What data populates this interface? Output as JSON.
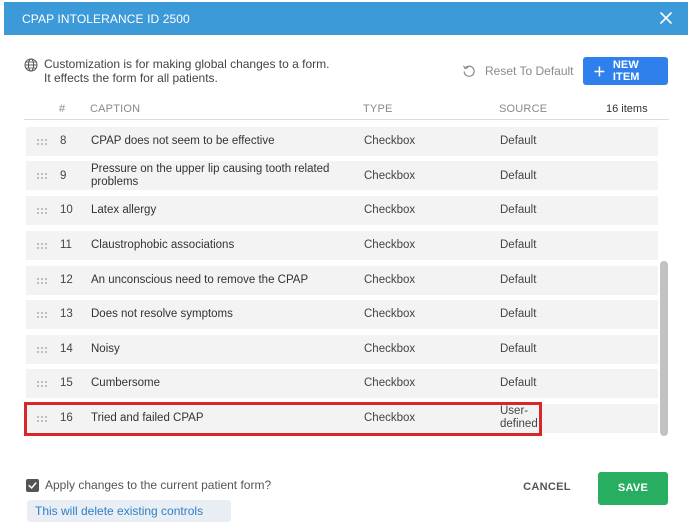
{
  "dialog": {
    "title": "CPAP INTOLERANCE  ID 2500",
    "close_icon": "close-icon"
  },
  "info": {
    "icon": "globe-icon",
    "line1": "Customization is for making global changes to a form.",
    "line2": "It effects the form for all patients."
  },
  "toolbar": {
    "reset_icon": "reset-icon",
    "reset_label": "Reset To Default",
    "new_item_icon": "plus-icon",
    "new_item_label": "NEW ITEM"
  },
  "table": {
    "columns": {
      "num": "#",
      "caption": "CAPTION",
      "type": "TYPE",
      "source": "SOURCE"
    },
    "count_label": "16 items",
    "rows": [
      {
        "num": "8",
        "caption": "CPAP does not seem to be effective",
        "type": "Checkbox",
        "source": "Default"
      },
      {
        "num": "9",
        "caption": "Pressure on the upper lip causing tooth related problems",
        "type": "Checkbox",
        "source": "Default"
      },
      {
        "num": "10",
        "caption": "Latex allergy",
        "type": "Checkbox",
        "source": "Default"
      },
      {
        "num": "11",
        "caption": "Claustrophobic associations",
        "type": "Checkbox",
        "source": "Default"
      },
      {
        "num": "12",
        "caption": "An unconscious need to remove the CPAP",
        "type": "Checkbox",
        "source": "Default"
      },
      {
        "num": "13",
        "caption": "Does not resolve symptoms",
        "type": "Checkbox",
        "source": "Default"
      },
      {
        "num": "14",
        "caption": "Noisy",
        "type": "Checkbox",
        "source": "Default"
      },
      {
        "num": "15",
        "caption": "Cumbersome",
        "type": "Checkbox",
        "source": "Default"
      },
      {
        "num": "16",
        "caption": "Tried and failed CPAP",
        "type": "Checkbox",
        "source": "User-defined",
        "highlighted": true
      }
    ]
  },
  "footer": {
    "apply_label": "Apply changes to the current patient form?",
    "apply_checked": true,
    "warning": "This will delete existing controls data.",
    "cancel_label": "CANCEL",
    "save_label": "SAVE"
  },
  "colors": {
    "header": "#3d9ad8",
    "primary": "#2f80ed",
    "save": "#27ae60",
    "highlight_border": "#d9262b",
    "row_bg": "#f3f3f3"
  }
}
